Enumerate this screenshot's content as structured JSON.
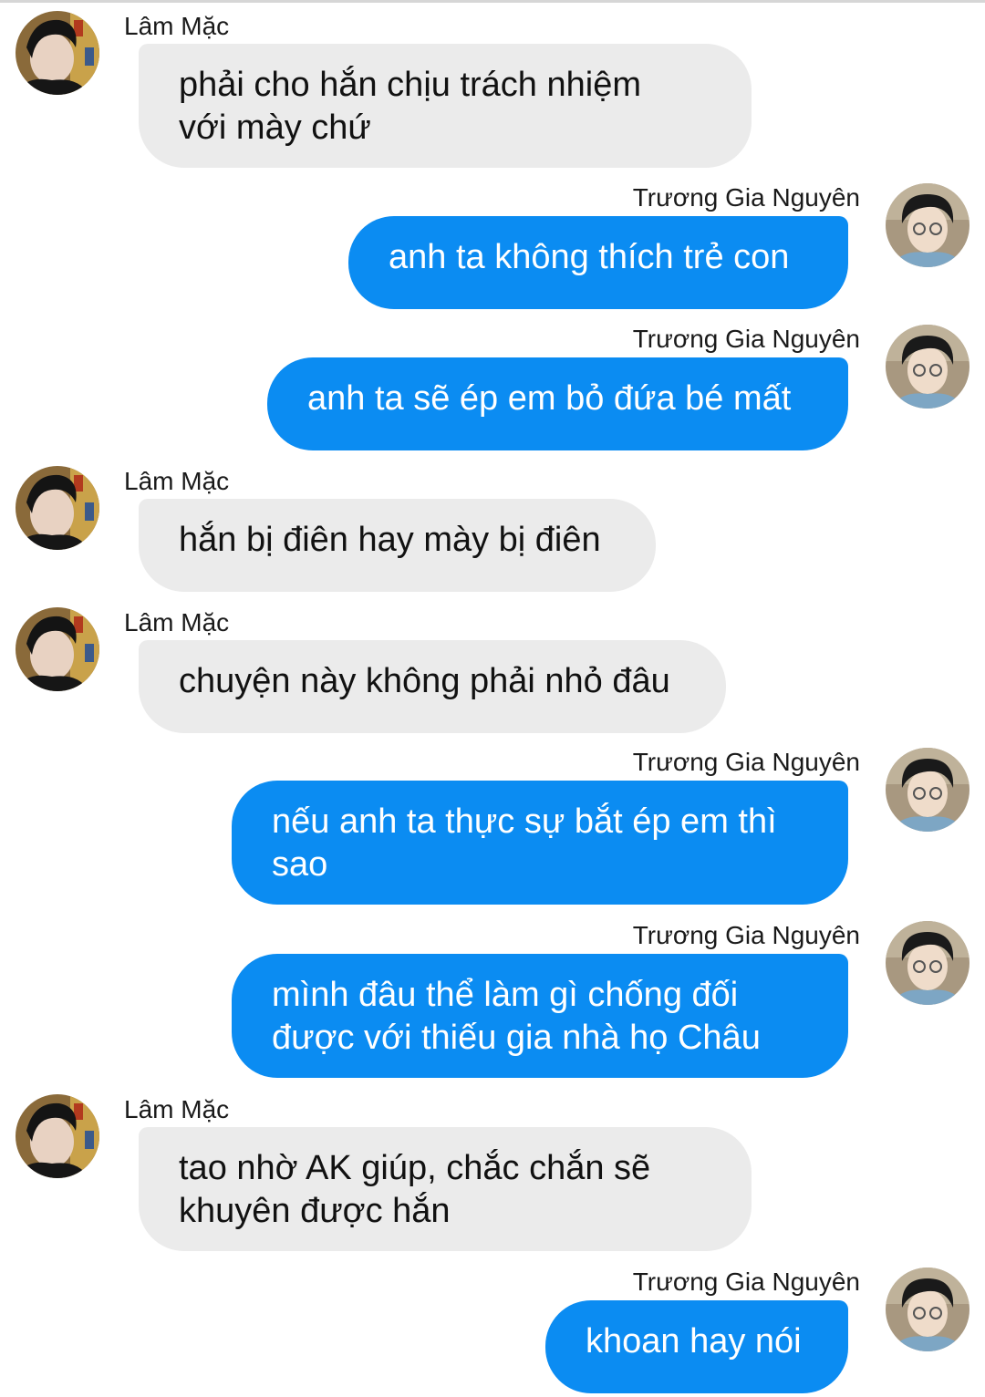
{
  "users": {
    "lam": {
      "name": "Lâm Mặc"
    },
    "truong": {
      "name": "Trương Gia Nguyên"
    }
  },
  "messages": [
    {
      "sender": "Lâm Mặc",
      "text": "phải cho hắn chịu trách nhiệm\nvới mày chứ"
    },
    {
      "sender": "Trương Gia Nguyên",
      "text": "anh ta không thích trẻ con"
    },
    {
      "sender": "Trương Gia Nguyên",
      "text": "anh ta sẽ ép em bỏ đứa bé mất"
    },
    {
      "sender": "Lâm Mặc",
      "text": "hắn bị điên hay mày bị điên"
    },
    {
      "sender": "Lâm Mặc",
      "text": "chuyện này không phải nhỏ đâu"
    },
    {
      "sender": "Trương Gia Nguyên",
      "text": "nếu anh ta thực sự bắt ép em thì\nsao"
    },
    {
      "sender": "Trương Gia Nguyên",
      "text": "mình đâu thể làm gì chống đối\nđược với thiếu gia nhà họ Châu"
    },
    {
      "sender": "Lâm Mặc",
      "text": "tao nhờ AK giúp, chắc chắn sẽ\nkhuyên được hắn"
    },
    {
      "sender": "Trương Gia Nguyên",
      "text": "khoan hay nói"
    }
  ]
}
